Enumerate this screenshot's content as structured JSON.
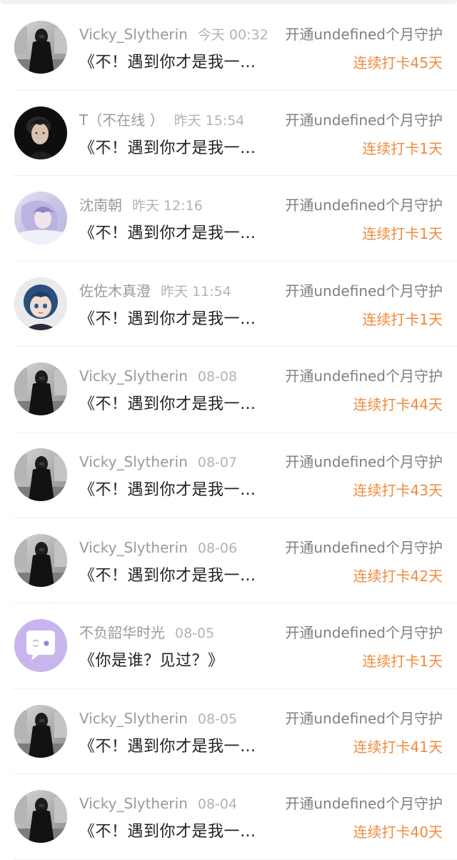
{
  "colors": {
    "streak": "#f28a3c",
    "name": "#9a9a9a",
    "title": "#222222",
    "action": "#7f7f7f"
  },
  "rows": [
    {
      "avatar": "avatar-dark-figure",
      "name": "Vicky_Slytherin",
      "time": "今天 00:32",
      "action": "开通undefined个月守护",
      "title": "《不！遇到你才是我一…",
      "streak": "连续打卡45天"
    },
    {
      "avatar": "avatar-boy-portrait",
      "name": "T（不在线 ）",
      "time": "昨天 15:54",
      "action": "开通undefined个月守护",
      "title": "《不！遇到你才是我一…",
      "streak": "连续打卡1天"
    },
    {
      "avatar": "avatar-pastel-illustration",
      "name": "沈南朝",
      "time": "昨天 12:16",
      "action": "开通undefined个月守护",
      "title": "《不！遇到你才是我一…",
      "streak": "连续打卡1天"
    },
    {
      "avatar": "avatar-blue-hair-girl",
      "name": "佐佐木真澄",
      "time": "昨天 11:54",
      "action": "开通undefined个月守护",
      "title": "《不！遇到你才是我一…",
      "streak": "连续打卡1天"
    },
    {
      "avatar": "avatar-dark-figure",
      "name": "Vicky_Slytherin",
      "time": "08-08",
      "action": "开通undefined个月守护",
      "title": "《不！遇到你才是我一…",
      "streak": "连续打卡44天"
    },
    {
      "avatar": "avatar-dark-figure",
      "name": "Vicky_Slytherin",
      "time": "08-07",
      "action": "开通undefined个月守护",
      "title": "《不！遇到你才是我一…",
      "streak": "连续打卡43天"
    },
    {
      "avatar": "avatar-dark-figure",
      "name": "Vicky_Slytherin",
      "time": "08-06",
      "action": "开通undefined个月守护",
      "title": "《不！遇到你才是我一…",
      "streak": "连续打卡42天"
    },
    {
      "avatar": "avatar-default-chat",
      "name": "不负韶华时光",
      "time": "08-05",
      "action": "开通undefined个月守护",
      "title": "《你是谁？见过？》",
      "streak": "连续打卡1天"
    },
    {
      "avatar": "avatar-dark-figure",
      "name": "Vicky_Slytherin",
      "time": "08-05",
      "action": "开通undefined个月守护",
      "title": "《不！遇到你才是我一…",
      "streak": "连续打卡41天"
    },
    {
      "avatar": "avatar-dark-figure",
      "name": "Vicky_Slytherin",
      "time": "08-04",
      "action": "开通undefined个月守护",
      "title": "《不！遇到你才是我一…",
      "streak": "连续打卡40天"
    }
  ]
}
